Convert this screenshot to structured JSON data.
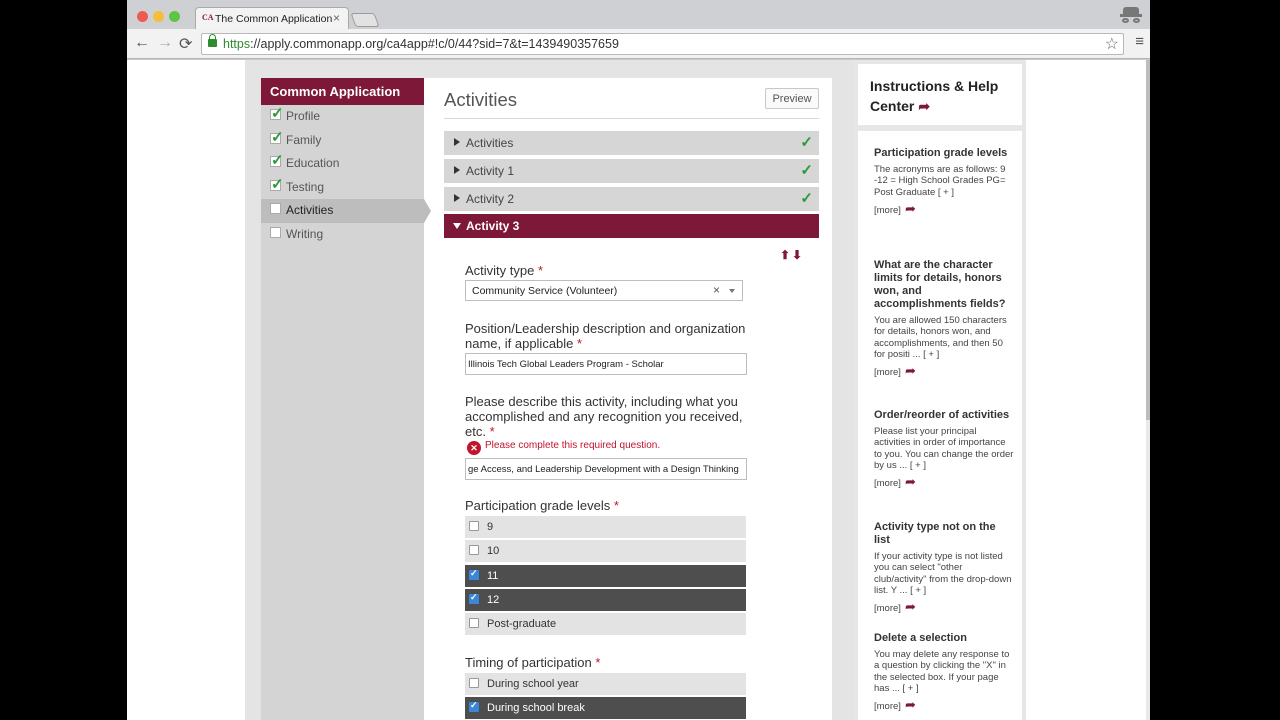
{
  "browser": {
    "tab_title": "The Common Application",
    "tab_favicon": "CA",
    "tab_close": "×",
    "url_scheme": "https",
    "url_rest": "://apply.commonapp.org/ca4app#!c/0/44?sid=7&t=1439490357659",
    "icons": {
      "back": "←",
      "forward": "→",
      "reload": "⟳",
      "star": "☆",
      "menu": "≡"
    }
  },
  "sidebar": {
    "heading": "Common Application",
    "items": [
      {
        "label": "Profile",
        "done": true
      },
      {
        "label": "Family",
        "done": true
      },
      {
        "label": "Education",
        "done": true
      },
      {
        "label": "Testing",
        "done": true
      },
      {
        "label": "Activities",
        "done": false,
        "active": true
      },
      {
        "label": "Writing",
        "done": false
      }
    ]
  },
  "main": {
    "title": "Activities",
    "preview_label": "Preview",
    "sections": [
      {
        "label": "Activities",
        "complete_mark": "✓"
      },
      {
        "label": "Activity 1",
        "complete_mark": "✓"
      },
      {
        "label": "Activity 2",
        "complete_mark": "✓"
      },
      {
        "label": "Activity 3"
      }
    ],
    "sort_arrows": "⬆⬇",
    "required_mark": "*",
    "activity_type": {
      "label": "Activity type",
      "value": "Community Service (Volunteer)",
      "clear": "×"
    },
    "position": {
      "label": "Position/Leadership description and organization name, if applicable",
      "value": "Illinois Tech Global Leaders Program - Scholar"
    },
    "description": {
      "label": "Please describe this activity, including what you accomplished and any recognition you received, etc.",
      "error_icon": "✕",
      "error": "Please complete this required question.",
      "value": "ge Access, and Leadership Development with a Design Thinking"
    },
    "grade_levels": {
      "label": "Participation grade levels",
      "options": [
        {
          "label": "9",
          "checked": false
        },
        {
          "label": "10",
          "checked": false
        },
        {
          "label": "11",
          "checked": true
        },
        {
          "label": "12",
          "checked": true
        },
        {
          "label": "Post-graduate",
          "checked": false
        }
      ]
    },
    "timing": {
      "label": "Timing of participation",
      "options": [
        {
          "label": "During school year",
          "checked": false
        },
        {
          "label": "During school break",
          "checked": true
        }
      ]
    }
  },
  "help": {
    "title": "Instructions & Help Center",
    "title_icon": "➦",
    "more_label": "[more]",
    "more_icon": "➦",
    "items": [
      {
        "q": "Participation grade levels",
        "a": "The acronyms are as follows: 9 -12 = High School Grades PG= Post Graduate [ + ]"
      },
      {
        "q": "What are the character limits for details, honors won, and accomplishments fields?",
        "a": "You are allowed 150 characters for details, honors won, and accomplishments, and then 50 for positi ... [ + ]"
      },
      {
        "q": "Order/reorder of activities",
        "a": "Please list your principal activities in order of importance to you. You can change the order by us ... [ + ]"
      },
      {
        "q": "Activity type not on the list",
        "a": "If your activity type is not listed you can select \"other club/activity\" from the drop-down list. Y ... [ + ]"
      },
      {
        "q": "Delete a selection",
        "a": "You may delete any response to a question by clicking the \"X\" in the selected box. If your page has ... [ + ]"
      }
    ]
  }
}
